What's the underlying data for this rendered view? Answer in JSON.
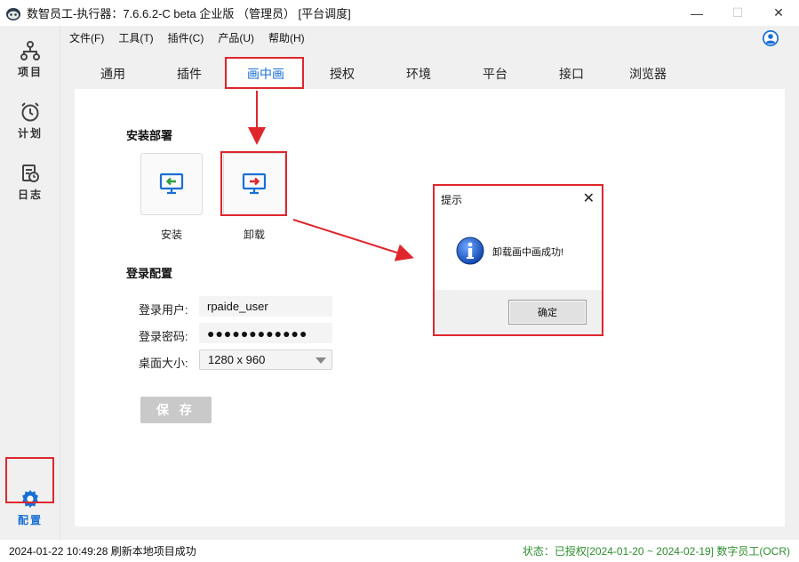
{
  "window": {
    "title": "数智员工-执行器：7.6.6.2-C beta 企业版 （管理员） [平台调度]",
    "minimize_icon": "minimize-icon",
    "maximize_icon": "maximize-icon",
    "close_icon": "close-icon"
  },
  "sidebar": {
    "items": [
      {
        "label": "项目",
        "icon": "project-icon"
      },
      {
        "label": "计划",
        "icon": "clock-icon"
      },
      {
        "label": "日志",
        "icon": "log-icon"
      },
      {
        "label": "配置",
        "icon": "gear-icon",
        "active": true
      }
    ]
  },
  "menu": {
    "items": [
      "文件(F)",
      "工具(T)",
      "插件(C)",
      "产品(U)",
      "帮助(H)"
    ],
    "user_icon": "user-icon"
  },
  "tabs": {
    "items": [
      "通用",
      "插件",
      "画中画",
      "授权",
      "环境",
      "平台",
      "接口",
      "浏览器"
    ],
    "active_index": 2
  },
  "deploy": {
    "section_title": "安装部署",
    "install_label": "安装",
    "uninstall_label": "卸载"
  },
  "login": {
    "section_title": "登录配置",
    "user_label": "登录用户:",
    "user_value": "rpaide_user",
    "password_label": "登录密码:",
    "password_value": "●●●●●●●●●●●●",
    "desktop_label": "桌面大小:",
    "desktop_value": "1280 x 960",
    "save_label": "保 存"
  },
  "dialog": {
    "title": "提示",
    "message": "卸载画中画成功!",
    "ok_label": "确定"
  },
  "status": {
    "left": "2024-01-22 10:49:28 刷新本地项目成功",
    "right": "状态：已授权[2024-01-20 ~ 2024-02-19] 数字员工(OCR)"
  },
  "colors": {
    "accent": "#1a6fd6",
    "highlight": "#e0262d",
    "status_ok": "#2d8f2d"
  }
}
